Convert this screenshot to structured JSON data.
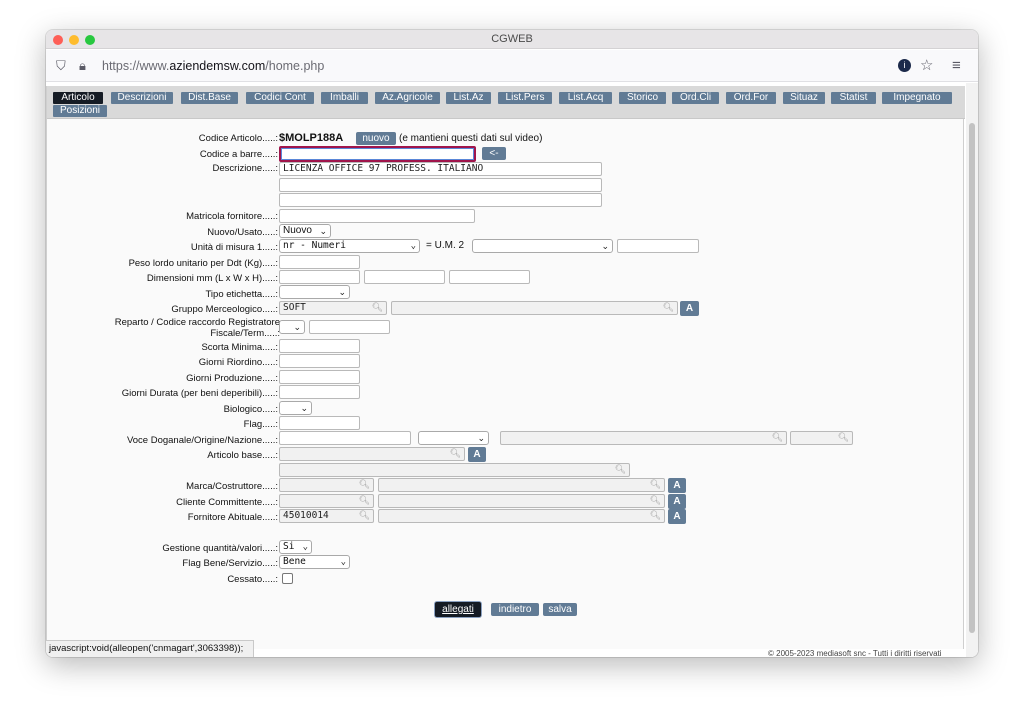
{
  "window": {
    "title": "CGWEB",
    "url_prefix": "https://www.",
    "url_domain": "aziendemsw.com",
    "url_path": "/home.php"
  },
  "tabs": [
    {
      "label": "Articolo"
    },
    {
      "label": "Descrizioni"
    },
    {
      "label": "Dist.Base"
    },
    {
      "label": "Codici Cont"
    },
    {
      "label": "Imballi"
    },
    {
      "label": "Az.Agricole"
    },
    {
      "label": "List.Az"
    },
    {
      "label": "List.Pers"
    },
    {
      "label": "List.Acq"
    },
    {
      "label": "Storico"
    },
    {
      "label": "Ord.Cli"
    },
    {
      "label": "Ord.For"
    },
    {
      "label": "Situaz"
    },
    {
      "label": "Statist"
    },
    {
      "label": "Impegnato"
    },
    {
      "label": "Posizioni"
    }
  ],
  "form": {
    "codice_articolo": {
      "label": "Codice Articolo.....:",
      "value": "$MOLP188A",
      "new_button": "nuovo",
      "note": "(e mantieni questi dati sul video)"
    },
    "codice_barre": {
      "label": "Codice a barre.....:",
      "value": "",
      "button": "<-"
    },
    "descrizione": {
      "label": "Descrizione.....:",
      "line1": "LICENZA OFFICE 97 PROFESS. ITALIANO",
      "line2": "",
      "line3": ""
    },
    "matricola": {
      "label": "Matricola fornitore.....:",
      "value": ""
    },
    "nuovo_usato": {
      "label": "Nuovo/Usato.....:",
      "value": "Nuovo"
    },
    "unita_misura": {
      "label": "Unità di misura 1.....:",
      "value": "nr - Numeri",
      "um2_label": "= U.M. 2",
      "um2_value": "",
      "extra": ""
    },
    "peso": {
      "label": "Peso lordo unitario per Ddt (Kg).....:",
      "value": ""
    },
    "dimensioni": {
      "label": "Dimensioni mm (L x W x H).....:",
      "l": "",
      "w": "",
      "h": ""
    },
    "tipo_etichetta": {
      "label": "Tipo etichetta.....:",
      "value": ""
    },
    "gruppo": {
      "label": "Gruppo Merceologico.....:",
      "code": "SOFT",
      "desc": "",
      "button": "A"
    },
    "reparto": {
      "label": "Reparto / Codice raccordo Registratore Fiscale/Term.....:",
      "value": "",
      "extra": ""
    },
    "scorta": {
      "label": "Scorta Minima.....:",
      "value": ""
    },
    "riordino": {
      "label": "Giorni Riordino.....:",
      "value": ""
    },
    "produzione": {
      "label": "Giorni Produzione.....:",
      "value": ""
    },
    "durata": {
      "label": "Giorni Durata (per beni deperibili).....:",
      "value": ""
    },
    "biologico": {
      "label": "Biologico.....:",
      "value": ""
    },
    "flag": {
      "label": "Flag.....:",
      "value": ""
    },
    "voce_doganale": {
      "label": "Voce Doganale/Origine/Nazione.....:",
      "value": "",
      "origine": "",
      "nazione": "",
      "code": ""
    },
    "articolo_base": {
      "label": "Articolo base.....:",
      "value": "",
      "desc": "",
      "button": "A"
    },
    "marca": {
      "label": "Marca/Costruttore.....:",
      "code": "",
      "desc": "",
      "button": "A"
    },
    "cliente": {
      "label": "Cliente Committente.....:",
      "code": "",
      "desc": "",
      "button": "A"
    },
    "fornitore": {
      "label": "Fornitore Abituale.....:",
      "code": "45010014",
      "desc": "",
      "button": "A"
    },
    "gestione": {
      "label": "Gestione quantità/valori.....:",
      "value": "Si"
    },
    "bene_servizio": {
      "label": "Flag Bene/Servizio.....:",
      "value": "Bene"
    },
    "cessato": {
      "label": "Cessato.....:"
    }
  },
  "actions": {
    "allegati": "allegati",
    "indietro": "indietro",
    "salva": "salva"
  },
  "status": {
    "link": "javascript:void(alleopen('cnmagart',3063398));",
    "copyright": "© 2005-2023 mediasoft snc - Tutti i diritti riservati"
  }
}
